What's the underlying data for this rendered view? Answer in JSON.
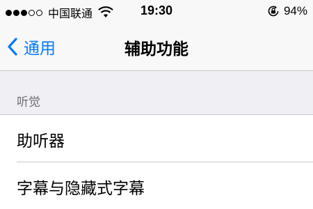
{
  "status_bar": {
    "signal": {
      "filled": 3,
      "total": 5
    },
    "carrier": "中国联通",
    "wifi_icon": "wifi-icon",
    "time": "19:30",
    "rotation_lock_icon": "rotation-lock-icon",
    "battery": "94%"
  },
  "nav": {
    "back_label": "通用",
    "back_icon": "chevron-left-icon",
    "title": "辅助功能"
  },
  "section": {
    "header": "听觉"
  },
  "items": [
    {
      "label": "助听器"
    },
    {
      "label": "字幕与隐藏式字幕"
    }
  ],
  "colors": {
    "accent": "#007aff",
    "bar_background": "#f8f8f8",
    "group_background": "#efeff4",
    "separator": "#c8c7cc",
    "section_text": "#6d6d72"
  }
}
